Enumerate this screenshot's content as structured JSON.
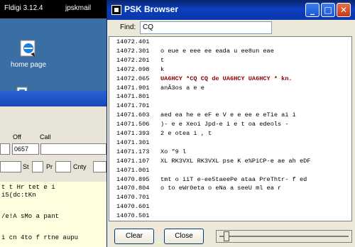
{
  "desktop": {
    "taskbar_left": "Fldigi 3.12.4",
    "taskbar_right": "jpskmail",
    "home_icon_label": "home page"
  },
  "fldigi": {
    "labels": {
      "off": "Off",
      "call": "Call",
      "st": "St",
      "pr": "Pr",
      "cnty": "Cnty"
    },
    "off_value": "0657",
    "rx_lines": [
      "t    t   Hr tet e  i",
      "i5(dc:tKn",
      "/e!A sMo   a   pant",
      "i  cn 4to f rtne aupu"
    ]
  },
  "psk_browser": {
    "title": "PSK Browser",
    "find_label": "Find:",
    "find_value": "CQ",
    "rows": [
      {
        "freq": "14072.401",
        "text": ""
      },
      {
        "freq": "14072.301",
        "text": "o eue e       eee     ee  eada u ee8un eae"
      },
      {
        "freq": "14072.201",
        "text": "t"
      },
      {
        "freq": "14072.098",
        "text": "k"
      },
      {
        "freq": "14072.065",
        "text": "UA6HCY *CQ CQ  de  UA6HCY  UA6HCY * kn.",
        "highlight": true
      },
      {
        "freq": "14071.901",
        "text": "anÂ3os a e e"
      },
      {
        "freq": "14071.801",
        "text": ""
      },
      {
        "freq": "14071.701",
        "text": ""
      },
      {
        "freq": "14071.603",
        "text": "aed ea he e eF e V e  e  ee e eTie  ai  i"
      },
      {
        "freq": "14071.506",
        "text": ")-  e e Xeoi Jpd-e i e t oa edeols      -"
      },
      {
        "freq": "14071.393",
        "text": "2  e otea  i , t"
      },
      {
        "freq": "14071.301",
        "text": ""
      },
      {
        "freq": "14071.173",
        "text": "Xo  \"9 l"
      },
      {
        "freq": "14071.107",
        "text": "XL RK3VXL RK3VXL pse K e%PiCP-e ae ah eDF"
      },
      {
        "freq": "14071.001",
        "text": ""
      },
      {
        "freq": "14070.895",
        "text": "tmt o  iiT e-ee5taeePe ataa PreThtr- f ed"
      },
      {
        "freq": "14070.804",
        "text": "o to eWr0eta      o eNa  a seeU   ml ea r"
      },
      {
        "freq": "14070.701",
        "text": ""
      },
      {
        "freq": "14070.601",
        "text": ""
      },
      {
        "freq": "14070.501",
        "text": ""
      }
    ],
    "clear_label": "Clear",
    "close_label": "Close",
    "minimize_glyph": "_",
    "maximize_glyph": "□",
    "close_glyph": "✕"
  },
  "colors": {
    "title_bar": "#0c3fbf",
    "highlight_text": "#8b0000",
    "rx_background": "#ffffe0"
  }
}
